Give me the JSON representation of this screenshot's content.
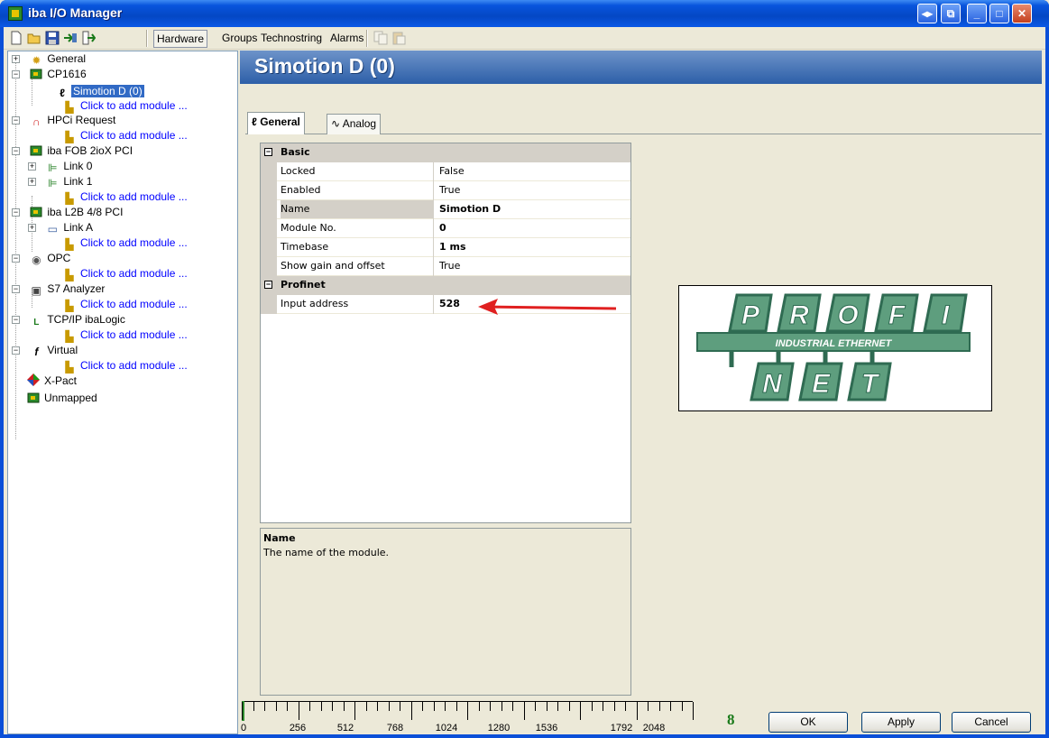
{
  "window": {
    "title": "iba I/O Manager",
    "controls": [
      "◂▸",
      "⧉",
      "_",
      "□",
      "✕"
    ]
  },
  "toolbar": {
    "tabs": [
      "Hardware",
      "Groups",
      "Technostring",
      "Alarms"
    ],
    "active_tab": "Hardware"
  },
  "tree": {
    "items": [
      {
        "label": "General",
        "icon": "gear-icon"
      },
      {
        "label": "CP1616",
        "icon": "board-icon"
      },
      {
        "label": "Simotion D (0)",
        "icon": "module-icon"
      },
      {
        "label": "Click to add module ...",
        "icon": "add-module-icon"
      },
      {
        "label": "HPCi Request",
        "icon": "hpci-icon"
      },
      {
        "label": "Click to add module ...",
        "icon": "add-module-icon"
      },
      {
        "label": "iba FOB 2ioX PCI",
        "icon": "board-icon"
      },
      {
        "label": "Link 0",
        "icon": "link-icon"
      },
      {
        "label": "Link 1",
        "icon": "link-icon"
      },
      {
        "label": "Click to add module ...",
        "icon": "add-module-icon"
      },
      {
        "label": "iba L2B 4/8 PCI",
        "icon": "board-icon"
      },
      {
        "label": "Link A",
        "icon": "cable-icon"
      },
      {
        "label": "Click to add module ...",
        "icon": "add-module-icon"
      },
      {
        "label": "OPC",
        "icon": "opc-icon"
      },
      {
        "label": "Click to add module ...",
        "icon": "add-module-icon"
      },
      {
        "label": "S7 Analyzer",
        "icon": "analyzer-icon"
      },
      {
        "label": "Click to add module ...",
        "icon": "add-module-icon"
      },
      {
        "label": "TCP/IP ibaLogic",
        "icon": "logic-icon"
      },
      {
        "label": "Click to add module ...",
        "icon": "add-module-icon"
      },
      {
        "label": "Virtual",
        "icon": "function-icon"
      },
      {
        "label": "Click to add module ...",
        "icon": "add-module-icon"
      },
      {
        "label": "X-Pact",
        "icon": "xpact-icon"
      },
      {
        "label": "Unmapped",
        "icon": "board-icon"
      }
    ]
  },
  "header": {
    "title": "Simotion D (0)"
  },
  "tabs": [
    {
      "label": "General",
      "icon": "module-icon"
    },
    {
      "label": "Analog",
      "icon": "wave-icon"
    }
  ],
  "properties": {
    "categories": [
      {
        "name": "Basic",
        "rows": [
          {
            "key": "Locked",
            "value": "False"
          },
          {
            "key": "Enabled",
            "value": "True"
          },
          {
            "key": "Name",
            "value": "Simotion D"
          },
          {
            "key": "Module No.",
            "value": "0"
          },
          {
            "key": "Timebase",
            "value": "1 ms"
          },
          {
            "key": "Show gain and offset",
            "value": "True"
          }
        ]
      },
      {
        "name": "Profinet",
        "rows": [
          {
            "key": "Input address",
            "value": "528"
          }
        ]
      }
    ]
  },
  "description": {
    "title": "Name",
    "text": "The name of the module."
  },
  "logo": {
    "top_letters": [
      "P",
      "R",
      "O",
      "F",
      "I"
    ],
    "band": "INDUSTRIAL ETHERNET",
    "bottom_letters": [
      "N",
      "E",
      "T"
    ],
    "colors": {
      "tile": "#5e9e7e",
      "tile_dark": "#2f6b52",
      "letter": "#ffffff"
    }
  },
  "ruler": {
    "labels": [
      "0",
      "256",
      "512",
      "768",
      "1024",
      "1280",
      "1536",
      "1792",
      "2048"
    ]
  },
  "footer": {
    "counter": "8",
    "ok_label": "OK",
    "apply_label": "Apply",
    "cancel_label": "Cancel"
  },
  "colors": {
    "selection": "#316ac5",
    "link": "#0000ff",
    "header_band": "#4a78bb",
    "arrow": "#e02020"
  }
}
